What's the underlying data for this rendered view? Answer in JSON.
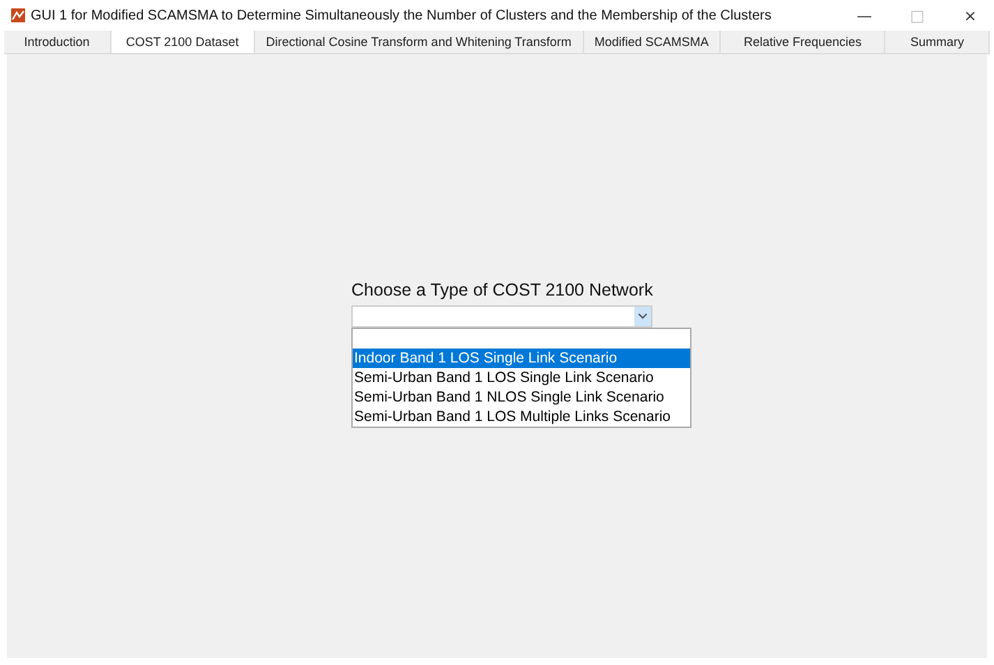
{
  "window": {
    "title": "GUI 1 for Modified SCAMSMA to Determine Simultaneously the Number of Clusters and the Membership of the Clusters",
    "controls": [
      "—",
      "□",
      "×"
    ]
  },
  "tabs": [
    {
      "label": "Introduction",
      "selected": false
    },
    {
      "label": "COST 2100 Dataset",
      "selected": true
    },
    {
      "label": "Directional Cosine Transform and Whitening Transform",
      "selected": false
    },
    {
      "label": "Modified SCAMSMA",
      "selected": false
    },
    {
      "label": "Relative Frequencies",
      "selected": false
    },
    {
      "label": "Summary",
      "selected": false
    }
  ],
  "panel": {
    "heading": "Choose a Type of COST 2100 Network",
    "dropdown": {
      "expanded": true,
      "options": [
        {
          "selected": false
        },
        {
          "label": "Indoor Band 1 LOS Single Link Scenario",
          "selected": true
        },
        {
          "label": "Semi-Urban Band 1 LOS Single Link Scenario",
          "selected": false
        },
        {
          "label": "Semi-Urban Band 1 NLOS Single Link Scenario",
          "selected": false
        },
        {
          "label": "Semi-Urban Band 1 LOS Multiple Links Scenario",
          "selected": false
        }
      ]
    }
  }
}
